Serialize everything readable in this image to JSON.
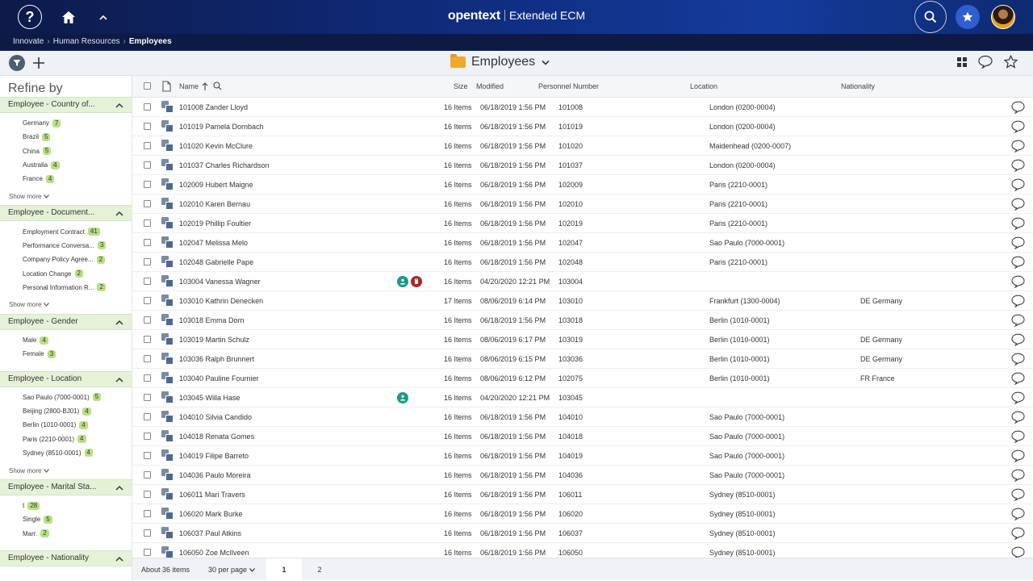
{
  "header": {
    "help_icon": "?",
    "brand_logo": "opentext",
    "brand_product": "Extended ECM"
  },
  "breadcrumb": [
    "Innovate",
    "Human Resources",
    "Employees"
  ],
  "toolbar": {
    "title": "Employees"
  },
  "sidebar": {
    "title": "Refine by",
    "facets": [
      {
        "name": "Employee - Country of...",
        "items": [
          [
            "Germany",
            "7"
          ],
          [
            "Brazil",
            "5"
          ],
          [
            "China",
            "5"
          ],
          [
            "Australia",
            "4"
          ],
          [
            "France",
            "4"
          ]
        ],
        "show_more": "Show more"
      },
      {
        "name": "Employee - Document...",
        "items": [
          [
            "Employment Contract",
            "41"
          ],
          [
            "Performance Conversa...",
            "3"
          ],
          [
            "Company Policy Agree...",
            "2"
          ],
          [
            "Location Change",
            "2"
          ],
          [
            "Personal Information R...",
            "2"
          ]
        ],
        "show_more": "Show more"
      },
      {
        "name": "Employee - Gender",
        "items": [
          [
            "Male",
            "4"
          ],
          [
            "Female",
            "3"
          ]
        ],
        "show_more": ""
      },
      {
        "name": "Employee - Location",
        "items": [
          [
            "Sao Paulo (7000-0001)",
            "5"
          ],
          [
            "Beijing (2800-BJ01)",
            "4"
          ],
          [
            "Berlin (1010-0001)",
            "4"
          ],
          [
            "Paris (2210-0001)",
            "4"
          ],
          [
            "Sydney (8510-0001)",
            "4"
          ]
        ],
        "show_more": "Show more"
      },
      {
        "name": "Employee - Marital Sta...",
        "items": [
          [
            "t",
            "28"
          ],
          [
            "Single",
            "5"
          ],
          [
            "Marr.",
            "2"
          ]
        ],
        "show_more": ""
      },
      {
        "name": "Employee - Nationality",
        "items": [],
        "show_more": ""
      }
    ]
  },
  "table": {
    "columns": {
      "name": "Name",
      "size": "Size",
      "modified": "Modified",
      "personnel": "Personnel Number",
      "location": "Location",
      "nationality": "Nationality"
    },
    "rows": [
      {
        "name": "101008 Zander Lloyd",
        "size": "16 Items",
        "modified": "06/18/2019 1:56 PM",
        "pn": "101008",
        "location": "London (0200-0004)",
        "nationality": "",
        "badges": []
      },
      {
        "name": "101019 Pamela Dornbach",
        "size": "16 Items",
        "modified": "06/18/2019 1:56 PM",
        "pn": "101019",
        "location": "London (0200-0004)",
        "nationality": "",
        "badges": []
      },
      {
        "name": "101020 Kevin McClure",
        "size": "16 Items",
        "modified": "06/18/2019 1:56 PM",
        "pn": "101020",
        "location": "Maidenhead (0200-0007)",
        "nationality": "",
        "badges": []
      },
      {
        "name": "101037 Charles Richardson",
        "size": "16 Items",
        "modified": "06/18/2019 1:56 PM",
        "pn": "101037",
        "location": "London (0200-0004)",
        "nationality": "",
        "badges": []
      },
      {
        "name": "102009 Hubert Maigne",
        "size": "16 Items",
        "modified": "06/18/2019 1:56 PM",
        "pn": "102009",
        "location": "Paris (2210-0001)",
        "nationality": "",
        "badges": []
      },
      {
        "name": "102010 Karen Bernau",
        "size": "16 Items",
        "modified": "06/18/2019 1:56 PM",
        "pn": "102010",
        "location": "Paris (2210-0001)",
        "nationality": "",
        "badges": []
      },
      {
        "name": "102019 Phillip Foultier",
        "size": "16 Items",
        "modified": "06/18/2019 1:56 PM",
        "pn": "102019",
        "location": "Paris (2210-0001)",
        "nationality": "",
        "badges": []
      },
      {
        "name": "102047 Melissa Melo",
        "size": "16 Items",
        "modified": "06/18/2019 1:56 PM",
        "pn": "102047",
        "location": "Sao Paulo (7000-0001)",
        "nationality": "",
        "badges": []
      },
      {
        "name": "102048 Gabrielle Pape",
        "size": "16 Items",
        "modified": "06/18/2019 1:56 PM",
        "pn": "102048",
        "location": "Paris (2210-0001)",
        "nationality": "",
        "badges": []
      },
      {
        "name": "103004 Vanessa Wagner",
        "size": "16 Items",
        "modified": "04/20/2020 12:21 PM",
        "pn": "103004",
        "location": "",
        "nationality": "",
        "badges": [
          "person-icon",
          "hand-icon"
        ]
      },
      {
        "name": "103010 Kathrin Denecken",
        "size": "17 Items",
        "modified": "08/06/2019 6:14 PM",
        "pn": "103010",
        "location": "Frankfurt (1300-0004)",
        "nationality": "DE Germany",
        "badges": []
      },
      {
        "name": "103018 Emma Dorn",
        "size": "16 Items",
        "modified": "06/18/2019 1:56 PM",
        "pn": "103018",
        "location": "Berlin (1010-0001)",
        "nationality": "",
        "badges": []
      },
      {
        "name": "103019 Martin Schulz",
        "size": "16 Items",
        "modified": "08/06/2019 6:17 PM",
        "pn": "103019",
        "location": "Berlin (1010-0001)",
        "nationality": "DE Germany",
        "badges": []
      },
      {
        "name": "103036 Ralph Brunnert",
        "size": "16 Items",
        "modified": "08/06/2019 6:15 PM",
        "pn": "103036",
        "location": "Berlin (1010-0001)",
        "nationality": "DE Germany",
        "badges": []
      },
      {
        "name": "103040 Pauline Fournier",
        "size": "16 Items",
        "modified": "08/06/2019 6:12 PM",
        "pn": "102075",
        "location": "Berlin (1010-0001)",
        "nationality": "FR France",
        "badges": []
      },
      {
        "name": "103045 Willa Hase",
        "size": "16 Items",
        "modified": "04/20/2020 12:21 PM",
        "pn": "103045",
        "location": "",
        "nationality": "",
        "badges": [
          "person-icon"
        ]
      },
      {
        "name": "104010 Silvia Candido",
        "size": "16 Items",
        "modified": "06/18/2019 1:56 PM",
        "pn": "104010",
        "location": "Sao Paulo (7000-0001)",
        "nationality": "",
        "badges": []
      },
      {
        "name": "104018 Renata Gomes",
        "size": "16 Items",
        "modified": "06/18/2019 1:56 PM",
        "pn": "104018",
        "location": "Sao Paulo (7000-0001)",
        "nationality": "",
        "badges": []
      },
      {
        "name": "104019 Filipe Barreto",
        "size": "16 Items",
        "modified": "06/18/2019 1:56 PM",
        "pn": "104019",
        "location": "Sao Paulo (7000-0001)",
        "nationality": "",
        "badges": []
      },
      {
        "name": "104036 Paulo Moreira",
        "size": "16 Items",
        "modified": "06/18/2019 1:56 PM",
        "pn": "104036",
        "location": "Sao Paulo (7000-0001)",
        "nationality": "",
        "badges": []
      },
      {
        "name": "106011 Mari Travers",
        "size": "16 Items",
        "modified": "06/18/2019 1:56 PM",
        "pn": "106011",
        "location": "Sydney (8510-0001)",
        "nationality": "",
        "badges": []
      },
      {
        "name": "106020 Mark Burke",
        "size": "16 Items",
        "modified": "06/18/2019 1:56 PM",
        "pn": "106020",
        "location": "Sydney (8510-0001)",
        "nationality": "",
        "badges": []
      },
      {
        "name": "106037 Paul Atkins",
        "size": "16 Items",
        "modified": "06/18/2019 1:56 PM",
        "pn": "106037",
        "location": "Sydney (8510-0001)",
        "nationality": "",
        "badges": []
      },
      {
        "name": "106050 Zoe McIlveen",
        "size": "16 Items",
        "modified": "06/18/2019 1:56 PM",
        "pn": "106050",
        "location": "Sydney (8510-0001)",
        "nationality": "",
        "badges": []
      }
    ]
  },
  "footer": {
    "count": "About 36 items",
    "per_page": "30 per page",
    "pages": [
      "1",
      "2"
    ]
  }
}
